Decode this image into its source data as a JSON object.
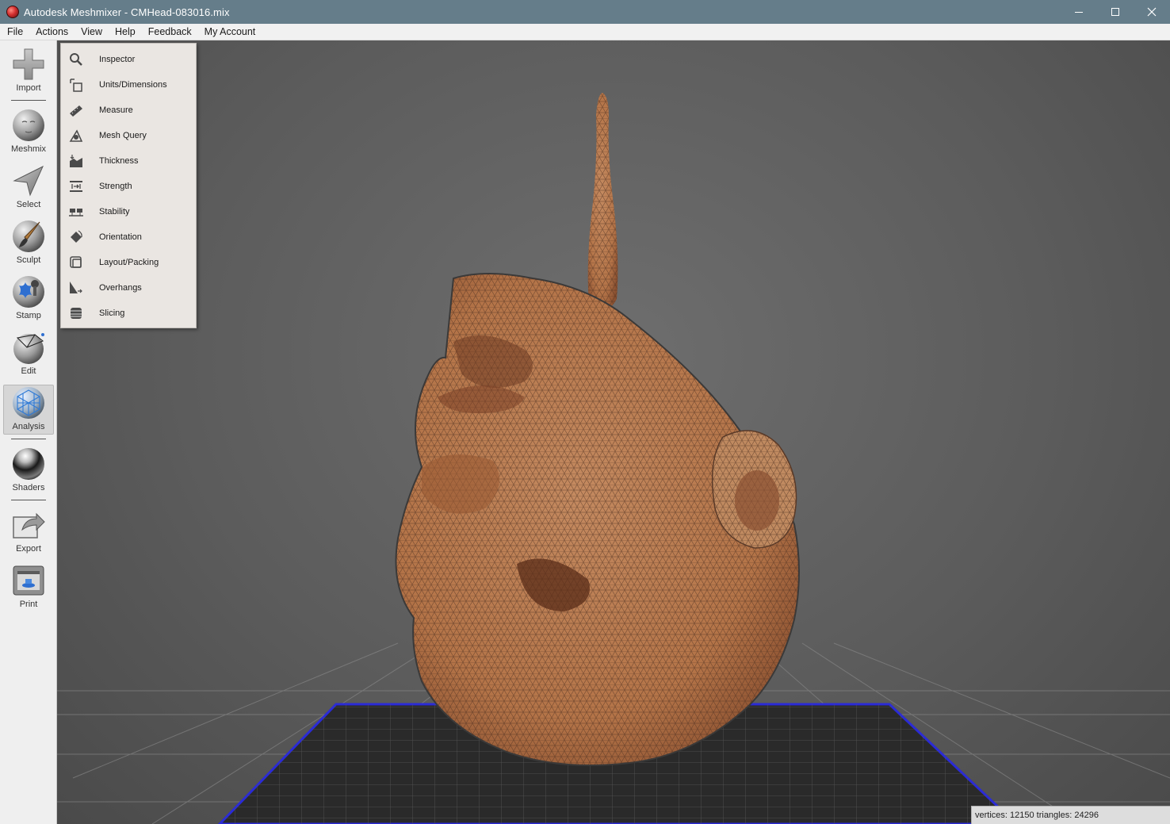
{
  "window": {
    "title": "Autodesk Meshmixer - CMHead-083016.mix",
    "controls": {
      "minimize": "minimize-icon",
      "maximize": "maximize-icon",
      "close": "close-icon"
    }
  },
  "menubar": {
    "items": [
      {
        "label": "File"
      },
      {
        "label": "Actions"
      },
      {
        "label": "View"
      },
      {
        "label": "Help"
      },
      {
        "label": "Feedback"
      },
      {
        "label": "My Account"
      }
    ]
  },
  "toolbar": {
    "items": [
      {
        "label": "Import",
        "icon": "plus-icon"
      },
      {
        "label": "Meshmix",
        "icon": "meshmix-sphere-icon"
      },
      {
        "label": "Select",
        "icon": "select-arrow-icon"
      },
      {
        "label": "Sculpt",
        "icon": "sculpt-brush-icon"
      },
      {
        "label": "Stamp",
        "icon": "stamp-icon"
      },
      {
        "label": "Edit",
        "icon": "edit-sphere-icon"
      },
      {
        "label": "Analysis",
        "icon": "analysis-sphere-icon",
        "active": true
      },
      {
        "label": "Shaders",
        "icon": "shader-sphere-icon"
      },
      {
        "label": "Export",
        "icon": "export-icon"
      },
      {
        "label": "Print",
        "icon": "printer-icon"
      }
    ]
  },
  "analysis_menu": {
    "items": [
      {
        "label": "Inspector",
        "icon": "magnifier-icon"
      },
      {
        "label": "Units/Dimensions",
        "icon": "units-icon"
      },
      {
        "label": "Measure",
        "icon": "ruler-icon"
      },
      {
        "label": "Mesh Query",
        "icon": "mesh-query-icon"
      },
      {
        "label": "Thickness",
        "icon": "thickness-icon"
      },
      {
        "label": "Strength",
        "icon": "strength-icon"
      },
      {
        "label": "Stability",
        "icon": "stability-icon"
      },
      {
        "label": "Orientation",
        "icon": "orientation-icon"
      },
      {
        "label": "Layout/Packing",
        "icon": "layout-packing-icon"
      },
      {
        "label": "Overhangs",
        "icon": "overhangs-icon"
      },
      {
        "label": "Slicing",
        "icon": "slicing-icon"
      }
    ]
  },
  "status": {
    "text": "vertices: 12150 triangles: 24296"
  },
  "colors": {
    "titlebar": "#657d8a",
    "mesh": "#b87a52",
    "platform_border": "#2b2bd6"
  }
}
